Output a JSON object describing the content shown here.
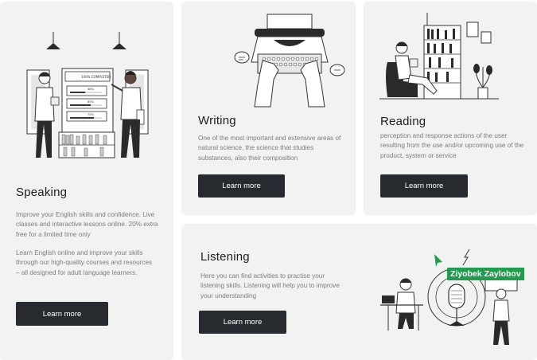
{
  "cards": {
    "speaking": {
      "title": "Speaking",
      "paragraph_1": "Improve your English skills and confidence. Live classes and interactive lessons online. 20% extra free for a limited time only",
      "paragraph_2": "Learn English online and improve your skills through our high-quality courses and resources – all designed for adult language learners.",
      "button_label": "Learn more",
      "progress": [
        {
          "label": "100% COMPLETED",
          "value": 1.0
        },
        {
          "label": "48%",
          "value": 0.48
        },
        {
          "label": "65%",
          "value": 0.65
        },
        {
          "label": "75%",
          "value": 0.75
        }
      ]
    },
    "writing": {
      "title": "Writing",
      "description": "One of the most important and extensive areas of natural science, the science that studies substances, also their composition",
      "button_label": "Learn more"
    },
    "reading": {
      "title": "Reading",
      "description": "perception and response actions of the user resulting from the use and/or upcoming use of the product, system or service",
      "button_label": "Learn more"
    },
    "listening": {
      "title": "Listening",
      "description": "Here you can find activities to practise your listening skills. Listening will help you to improve your understanding",
      "button_label": "Learn more"
    }
  },
  "cursor": {
    "name": "Ziyobek Zaylobov",
    "color": "#1f9d4c"
  },
  "colors": {
    "card_bg": "#f2f2f2",
    "button_bg": "#272a2f",
    "button_text": "#ffffff",
    "title": "#1e1e1e",
    "body_text": "#7d7d7d"
  }
}
